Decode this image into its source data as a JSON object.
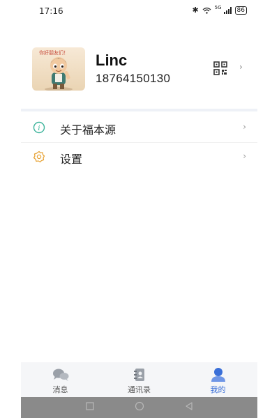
{
  "status_bar": {
    "time": "17:16",
    "battery": "86",
    "network": "5G"
  },
  "profile": {
    "name": "Linc",
    "phone": "18764150130",
    "avatar_caption": "你好朋友们！"
  },
  "menu": [
    {
      "label": "关于福本源",
      "icon": "info-icon",
      "color": "#3bb39a"
    },
    {
      "label": "设置",
      "icon": "gear-icon",
      "color": "#e8a53a"
    }
  ],
  "tabs": [
    {
      "label": "消息",
      "icon": "chat-bubbles-icon",
      "active": false
    },
    {
      "label": "通讯录",
      "icon": "contacts-book-icon",
      "active": false
    },
    {
      "label": "我的",
      "icon": "user-icon",
      "active": true
    }
  ],
  "colors": {
    "accent": "#3a6fd8",
    "nav_bar": "#8a8a8a",
    "divider": "#eef1f7"
  }
}
